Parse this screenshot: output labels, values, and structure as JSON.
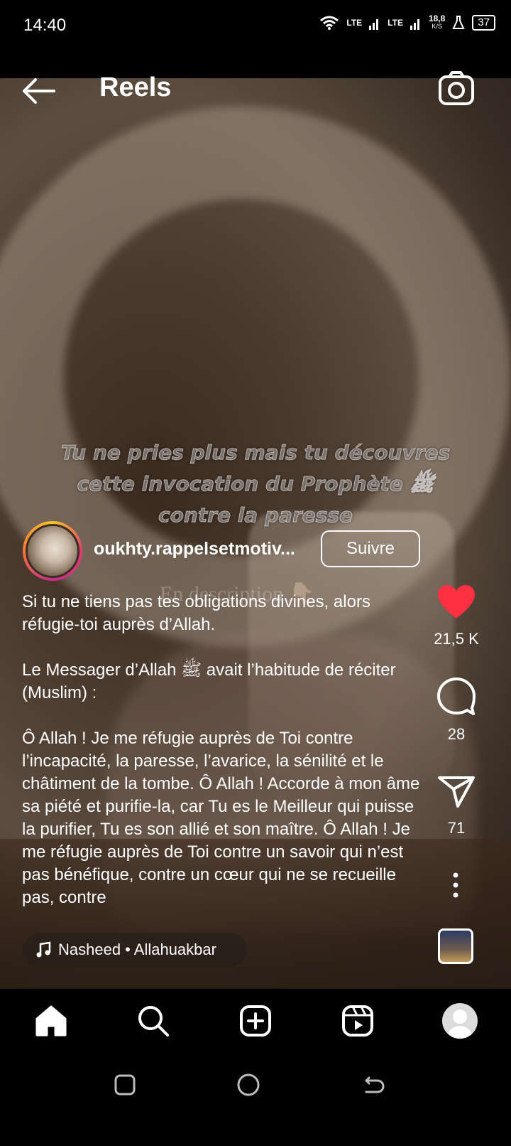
{
  "status_bar": {
    "time": "14:40",
    "wifi_icon": "wifi-icon",
    "signal_1": "LTE",
    "signal_2": "LTE",
    "speed_value": "18,8",
    "speed_unit": "K/S",
    "battery": "37"
  },
  "header": {
    "title": "Reels",
    "back_icon": "arrow-left-icon",
    "camera_icon": "camera-icon"
  },
  "video": {
    "overlay_title_line1": "Tu ne pries plus mais tu découvres",
    "overlay_title_line2": "cette invocation du Prophète ﷺ",
    "overlay_title_line3": "contre la paresse",
    "overlay_sub": "En description 👇🏻"
  },
  "author": {
    "username": "oukhty.rappelsetmotiv...",
    "follow_label": "Suivre"
  },
  "caption": {
    "para1": "Si tu ne tiens pas tes obligations divines, alors réfugie-toi auprès d’Allah.",
    "para2": "Le Messager d’Allah ﷺ avait l’habitude de réciter (Muslim) :",
    "para3": "Ô Allah ! Je me réfugie auprès de Toi contre l’incapacité, la paresse, l’avarice, la sénilité et le châtiment de la tombe. Ô Allah ! Accorde à mon âme sa piété et purifie-la, car Tu es le Meilleur qui puisse la purifier, Tu es son allié et son maître. Ô Allah ! Je me réfugie auprès de Toi contre un savoir qui n’est pas bénéfique, contre un cœur qui ne se recueille pas, contre"
  },
  "actions": {
    "like_count": "21,5 K",
    "comment_count": "28",
    "share_count": "71",
    "like_color": "#ff3040"
  },
  "audio": {
    "label": "Nasheed • Allahuakbar"
  },
  "bottom_nav": {
    "items": [
      "home-icon",
      "search-icon",
      "create-icon",
      "reels-icon",
      "profile-avatar"
    ]
  },
  "system_nav": {
    "items": [
      "recents-icon",
      "home-circle-icon",
      "back-icon"
    ]
  }
}
